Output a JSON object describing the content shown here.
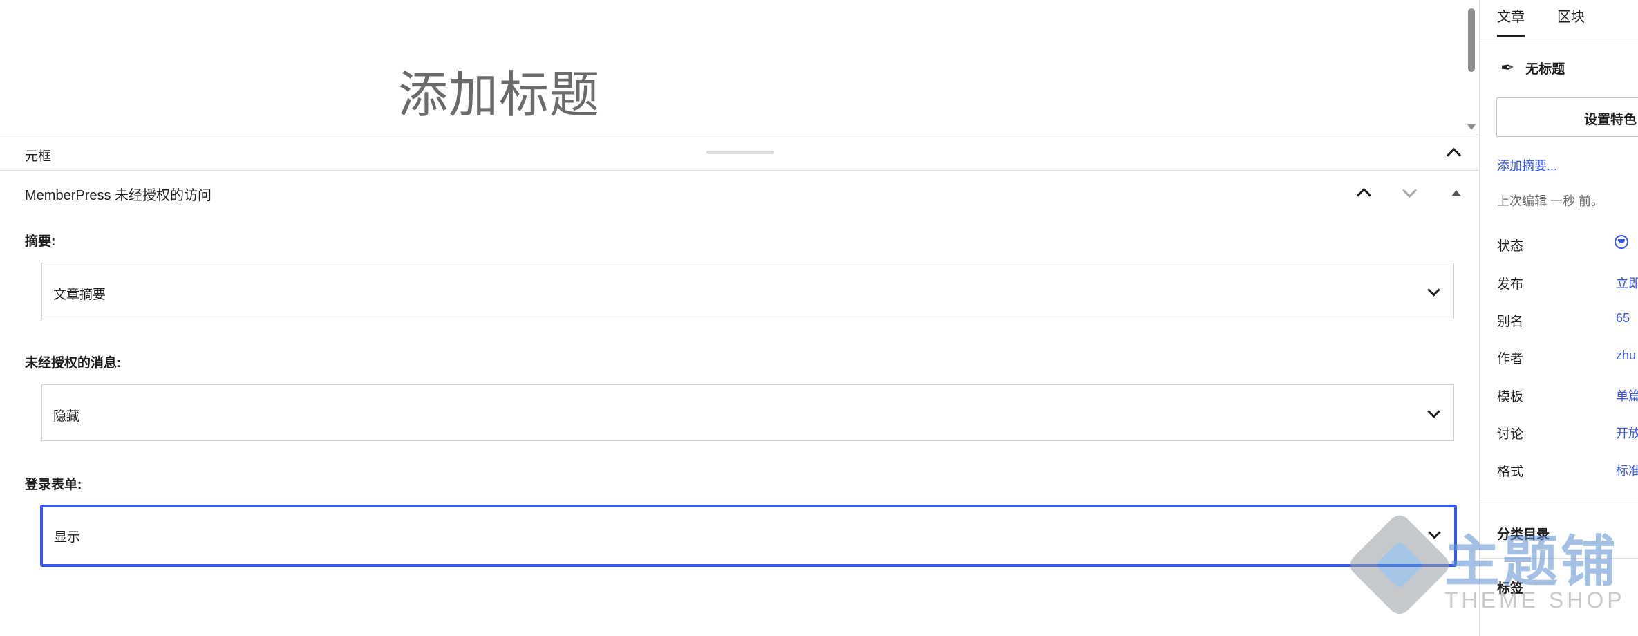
{
  "editor": {
    "post_title_placeholder": "添加标题",
    "metabox_area_title": "元框"
  },
  "memberpress_panel": {
    "heading": "MemberPress 未经授权的访问",
    "fields": [
      {
        "label": "摘要:",
        "value": "文章摘要"
      },
      {
        "label": "未经授权的消息:",
        "value": "隐藏"
      },
      {
        "label": "登录表单:",
        "value": "显示"
      }
    ]
  },
  "sidebar": {
    "tabs": [
      "文章",
      "区块"
    ],
    "active_tab": "文章",
    "post_name": "无标题",
    "featured_image_button": "设置特色",
    "add_excerpt_link": "添加摘要...",
    "last_edited": "上次编辑 一秒 前。",
    "meta": [
      {
        "key": "状态",
        "value": ""
      },
      {
        "key": "发布",
        "value": "立即"
      },
      {
        "key": "别名",
        "value": "65"
      },
      {
        "key": "作者",
        "value": "zhu"
      },
      {
        "key": "模板",
        "value": "单篇"
      },
      {
        "key": "讨论",
        "value": "开放"
      },
      {
        "key": "格式",
        "value": "标准"
      }
    ],
    "sections": [
      "分类目录",
      "标签"
    ]
  },
  "watermark": {
    "cn_text": "主题铺",
    "en_text": "THEME SHOP"
  },
  "colors": {
    "accent": "#3858e9",
    "border": "#dcdcde",
    "muted_text": "#6b6b6b"
  }
}
